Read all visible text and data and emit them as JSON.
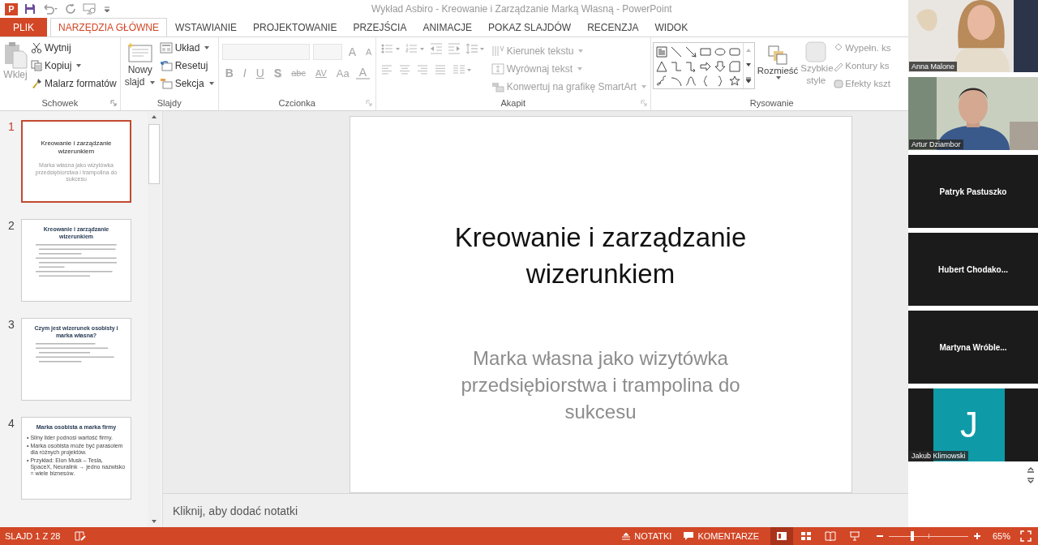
{
  "app": {
    "logo": "P",
    "title": "Wykład Asbiro - Kreowanie i Zarządzanie Marką Własną - PowerPoint"
  },
  "tabs": [
    {
      "label": "PLIK",
      "kind": "file",
      "selected": false
    },
    {
      "label": "NARZĘDZIA GŁÓWNE",
      "kind": "tab",
      "selected": true
    },
    {
      "label": "WSTAWIANIE",
      "kind": "tab",
      "selected": false
    },
    {
      "label": "PROJEKTOWANIE",
      "kind": "tab",
      "selected": false
    },
    {
      "label": "PRZEJŚCIA",
      "kind": "tab",
      "selected": false
    },
    {
      "label": "ANIMACJE",
      "kind": "tab",
      "selected": false
    },
    {
      "label": "POKAZ SLAJDÓW",
      "kind": "tab",
      "selected": false
    },
    {
      "label": "RECENZJA",
      "kind": "tab",
      "selected": false
    },
    {
      "label": "WIDOK",
      "kind": "tab",
      "selected": false
    }
  ],
  "ribbon": {
    "clipboard": {
      "label": "Schowek",
      "paste": {
        "label": "Wklej",
        "disabled": true
      },
      "cut": "Wytnij",
      "copy": "Kopiuj",
      "painter": "Malarz formatów"
    },
    "slides": {
      "label": "Slajdy",
      "new_slide": "Nowy slajd",
      "layout": "Układ",
      "reset": "Resetuj",
      "section": "Sekcja"
    },
    "font": {
      "label": "Czcionka",
      "disabled": true,
      "grow": "A",
      "shrink": "A",
      "buttons": [
        {
          "text": "B",
          "kind": "bold"
        },
        {
          "text": "I",
          "kind": "italic"
        },
        {
          "text": "U",
          "kind": "underline"
        },
        {
          "text": "S",
          "kind": "shadow"
        },
        {
          "text": "abc",
          "kind": "strike"
        },
        {
          "text": "AV",
          "kind": "spacing"
        },
        {
          "text": "Aa",
          "kind": "case"
        },
        {
          "text": "A",
          "kind": "color"
        }
      ]
    },
    "paragraph": {
      "label": "Akapit",
      "disabled": true,
      "text_direction": "Kierunek tekstu",
      "align_text": "Wyrównaj tekst",
      "smartart": "Konwertuj na grafikę SmartArt"
    },
    "drawing": {
      "label": "Rysowanie",
      "arrange": "Rozmieść",
      "quick_styles": "Szybkie style",
      "fill": "Wypełn. ks",
      "outline": "Kontury ks",
      "effects": "Efekty kszt",
      "disabled": true
    }
  },
  "thumbnails": [
    {
      "number": "1",
      "selected": true,
      "kind": "title",
      "title": "Kreowanie i zarządzanie wizerunkiem",
      "subtitle": "Marka własna jako wizytówka przedsiębiorstwa i trampolina do sukcesu"
    },
    {
      "number": "2",
      "selected": false,
      "kind": "content",
      "title": "Kreowanie i zarządzanie wizerunkiem"
    },
    {
      "number": "3",
      "selected": false,
      "kind": "content",
      "title": "Czym jest wizerunek osobisty i marka własna?"
    },
    {
      "number": "4",
      "selected": false,
      "kind": "content",
      "title": "Marka osobista a marka firmy",
      "bullet": "•",
      "bullets": [
        "Silny lider podnosi wartość firmy.",
        "Marka osobista może być parasolem dla różnych projektów.",
        "Przykład: Elon Musk – Tesla, SpaceX, Neuralink → jedno nazwisko = wiele biznesów."
      ]
    }
  ],
  "slide": {
    "title": "Kreowanie i zarządzanie wizerunkiem",
    "subtitle": "Marka własna jako wizytówka przedsiębiorstwa i trampolina do sukcesu"
  },
  "notes": {
    "placeholder": "Kliknij, aby dodać notatki"
  },
  "status_bar": {
    "slide": "SLAJD 1 Z 28",
    "notes": "NOTATKI",
    "comments": "KOMENTARZE",
    "views": [
      {
        "selected": true
      },
      {
        "selected": false
      },
      {
        "selected": false
      },
      {
        "selected": false
      }
    ],
    "zoom": {
      "level": 0.3
    },
    "zoom_text": "65%"
  },
  "participants": [
    {
      "kind": "video",
      "name": "Anna Malone"
    },
    {
      "kind": "video",
      "name": "Artur Dziambor"
    },
    {
      "kind": "name",
      "name": "Patryk Pastuszko"
    },
    {
      "kind": "name",
      "name": "Hubert Chodako..."
    },
    {
      "kind": "name",
      "name": "Martyna Wróble..."
    },
    {
      "kind": "avatar",
      "initial": "J",
      "name": "Jakub Klimowski"
    }
  ]
}
